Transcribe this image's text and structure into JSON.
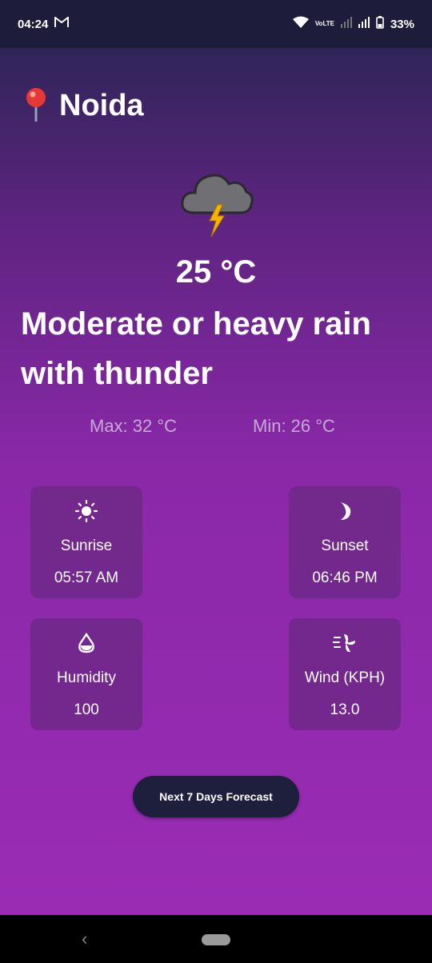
{
  "status_bar": {
    "time": "04:24",
    "battery": "33%",
    "volte_label": "VoLTE"
  },
  "location": {
    "name": "Noida"
  },
  "current": {
    "temperature": "25 °C",
    "condition": "Moderate or heavy rain with thunder",
    "max": "Max: 32 °C",
    "min": "Min: 26 °C"
  },
  "cards": {
    "sunrise": {
      "label": "Sunrise",
      "value": "05:57 AM"
    },
    "sunset": {
      "label": "Sunset",
      "value": "06:46 PM"
    },
    "humidity": {
      "label": "Humidity",
      "value": "100"
    },
    "wind": {
      "label": "Wind (KPH)",
      "value": "13.0"
    }
  },
  "forecast_button": {
    "label": "Next 7 Days Forecast"
  },
  "colors": {
    "button_bg": "#1d1f3d",
    "card_bg": "#6e2887",
    "gradient_top": "#2f2558",
    "gradient_bottom": "#9a2cb4"
  }
}
